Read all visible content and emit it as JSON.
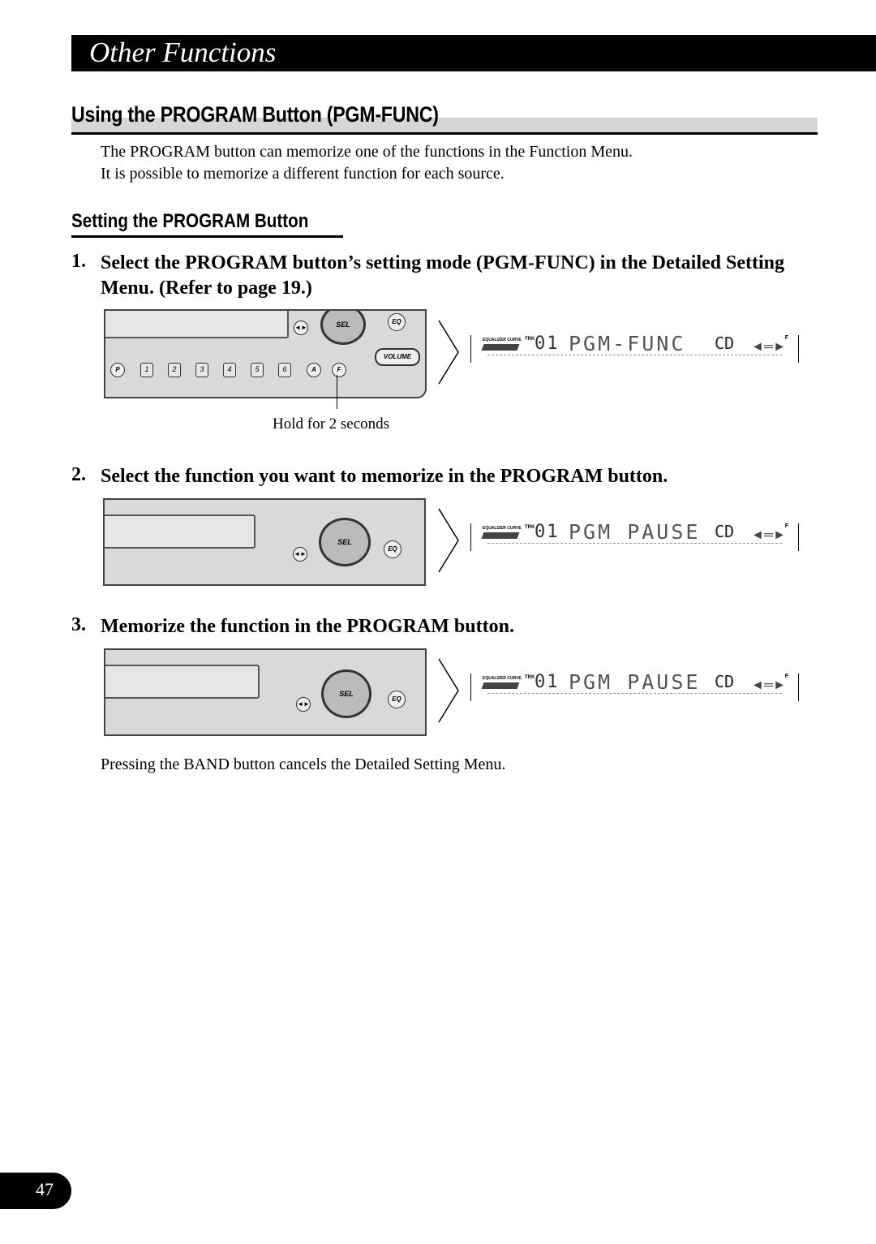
{
  "header": {
    "title": "Other Functions"
  },
  "section": {
    "title": "Using the PROGRAM Button (PGM-FUNC)",
    "intro": [
      "The PROGRAM button can memorize one of the functions in the Function Menu.",
      "It is possible to memorize a different function for each source."
    ]
  },
  "subsection": {
    "title": "Setting the PROGRAM Button"
  },
  "steps": [
    {
      "num": "1.",
      "text": "Select the PROGRAM button’s setting mode (PGM-FUNC) in the Detailed Setting Menu. (Refer to page 19.)",
      "caption": "Hold for 2 seconds",
      "display": {
        "main": "PGM-FUNC"
      }
    },
    {
      "num": "2.",
      "text": "Select the function you want to memorize in the PROGRAM button.",
      "display": {
        "main": "PGM PAUSE"
      }
    },
    {
      "num": "3.",
      "text": "Memorize the function in the PROGRAM button.",
      "display": {
        "main": "PGM PAUSE"
      }
    }
  ],
  "device": {
    "sel": "SEL",
    "eq": "EQ",
    "volume": "VOLUME",
    "seek": "◄►",
    "buttons": [
      "P",
      "1",
      "2",
      "3",
      "4",
      "5",
      "6",
      "A",
      "F"
    ]
  },
  "display": {
    "eq_label": "EQUALIZER CURVE",
    "trk": "TRK",
    "track": "01",
    "source": "CD",
    "f": "F",
    "dir": "◄═►"
  },
  "note": "Pressing the BAND button cancels the Detailed Setting Menu.",
  "page_number": "47"
}
